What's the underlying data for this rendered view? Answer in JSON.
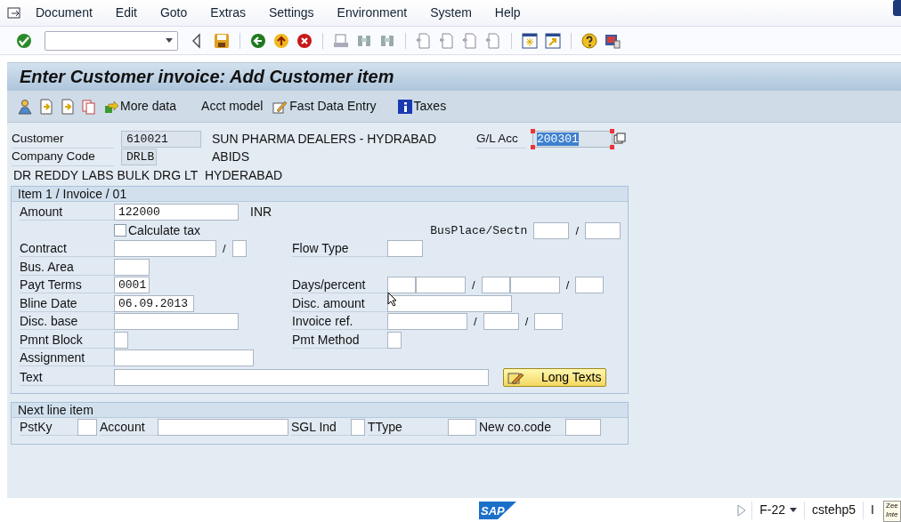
{
  "menu_bar": {
    "items": [
      "Document",
      "Edit",
      "Goto",
      "Extras",
      "Settings",
      "Environment",
      "System",
      "Help"
    ]
  },
  "title": "Enter Customer invoice: Add Customer item",
  "app_toolbar": {
    "buttons": [
      "More data",
      "Acct model",
      "Fast Data Entry",
      "Taxes"
    ]
  },
  "header": {
    "customer": {
      "label": "Customer",
      "value": "610021",
      "readonly": true,
      "name": "SUN PHARMA DEALERS - HYDRABAD"
    },
    "company_code": {
      "label": "Company Code",
      "value": "DRLB",
      "readonly": true,
      "city": "ABIDS"
    },
    "company_name": "DR REDDY LABS BULK DRG LT",
    "company_city": "HYDERABAD",
    "gl_account": {
      "label": "G/L Acc",
      "value": "200301",
      "selected": true
    }
  },
  "item_section": {
    "title": "Item 1 / Invoice / 01",
    "rows": [
      {
        "left": [
          {
            "kind": "label",
            "text": "Amount"
          },
          {
            "kind": "input",
            "value": "122000"
          },
          {
            "kind": "text",
            "text": "INR"
          }
        ]
      },
      {
        "left": [
          {
            "kind": "checkbox",
            "text": "Calculate tax",
            "checked": false
          }
        ],
        "right": [
          {
            "kind": "mono-label",
            "text": "BusPlace/Sectn"
          },
          {
            "kind": "input"
          },
          {
            "kind": "sep",
            "text": "/"
          },
          {
            "kind": "input"
          }
        ]
      },
      {
        "left": [
          {
            "kind": "label",
            "text": "Contract"
          },
          {
            "kind": "input"
          },
          {
            "kind": "sep",
            "text": "/"
          },
          {
            "kind": "input"
          }
        ],
        "right": [
          {
            "kind": "label",
            "text": "Flow Type"
          },
          {
            "kind": "input"
          }
        ]
      },
      {
        "left": [
          {
            "kind": "label",
            "text": "Bus. Area"
          },
          {
            "kind": "input"
          }
        ]
      },
      {
        "left": [
          {
            "kind": "label",
            "text": "Payt Terms"
          },
          {
            "kind": "input",
            "value": "0001"
          }
        ],
        "right": [
          {
            "kind": "label",
            "text": "Days/percent"
          },
          {
            "kind": "input"
          },
          {
            "kind": "input"
          },
          {
            "kind": "sep",
            "text": "/"
          },
          {
            "kind": "input"
          },
          {
            "kind": "input"
          },
          {
            "kind": "sep",
            "text": "/"
          },
          {
            "kind": "input"
          }
        ]
      },
      {
        "left": [
          {
            "kind": "label",
            "text": "Bline Date"
          },
          {
            "kind": "input",
            "value": "06.09.2013"
          }
        ],
        "right": [
          {
            "kind": "label",
            "text": "Disc. amount"
          },
          {
            "kind": "input"
          }
        ]
      },
      {
        "left": [
          {
            "kind": "label",
            "text": "Disc. base"
          },
          {
            "kind": "input"
          }
        ],
        "right": [
          {
            "kind": "label",
            "text": "Invoice ref."
          },
          {
            "kind": "input"
          },
          {
            "kind": "sep",
            "text": "/"
          },
          {
            "kind": "input"
          },
          {
            "kind": "sep",
            "text": "/"
          },
          {
            "kind": "input"
          }
        ]
      },
      {
        "left": [
          {
            "kind": "label",
            "text": "Pmnt Block"
          },
          {
            "kind": "input"
          }
        ],
        "right": [
          {
            "kind": "label",
            "text": "Pmt Method"
          },
          {
            "kind": "input"
          }
        ]
      },
      {
        "left": [
          {
            "kind": "label",
            "text": "Assignment"
          },
          {
            "kind": "input"
          }
        ]
      },
      {
        "left": [
          {
            "kind": "label",
            "text": "Text"
          },
          {
            "kind": "input"
          }
        ],
        "right": [
          {
            "kind": "button",
            "text": "Long Texts"
          }
        ]
      }
    ]
  },
  "next_line_section": {
    "title": "Next line item",
    "fields": [
      "PstKy",
      "Account",
      "SGL Ind",
      "TType",
      "New co.code"
    ]
  },
  "status_bar": {
    "logo": "SAP",
    "transaction": "F-22",
    "server": "cstehp5",
    "extra": "I",
    "tooltip": [
      "Zee",
      "Inte"
    ]
  }
}
